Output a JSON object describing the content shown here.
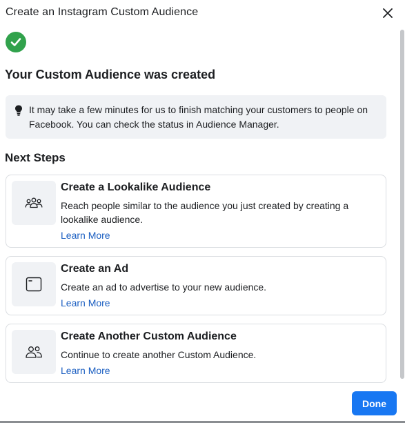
{
  "dialog": {
    "title": "Create an Instagram Custom Audience",
    "close_icon": "close-icon"
  },
  "status": {
    "icon": "check-circle-icon",
    "icon_color": "#31a24c",
    "heading": "Your Custom Audience was created"
  },
  "info": {
    "icon": "lightbulb-icon",
    "text": "It may take a few minutes for us to finish matching your customers to people on Facebook. You can check the status in Audience Manager."
  },
  "next_steps": {
    "heading": "Next Steps",
    "cards": [
      {
        "icon": "people-group-icon",
        "title": "Create a Lookalike Audience",
        "description": "Reach people similar to the audience you just created by creating a lookalike audience.",
        "link": "Learn More"
      },
      {
        "icon": "ad-window-icon",
        "title": "Create an Ad",
        "description": "Create an ad to advertise to your new audience.",
        "link": "Learn More"
      },
      {
        "icon": "people-pair-icon",
        "title": "Create Another Custom Audience",
        "description": "Continue to create another Custom Audience.",
        "link": "Learn More"
      }
    ]
  },
  "footer": {
    "done_label": "Done",
    "accent": "#1877f2"
  }
}
